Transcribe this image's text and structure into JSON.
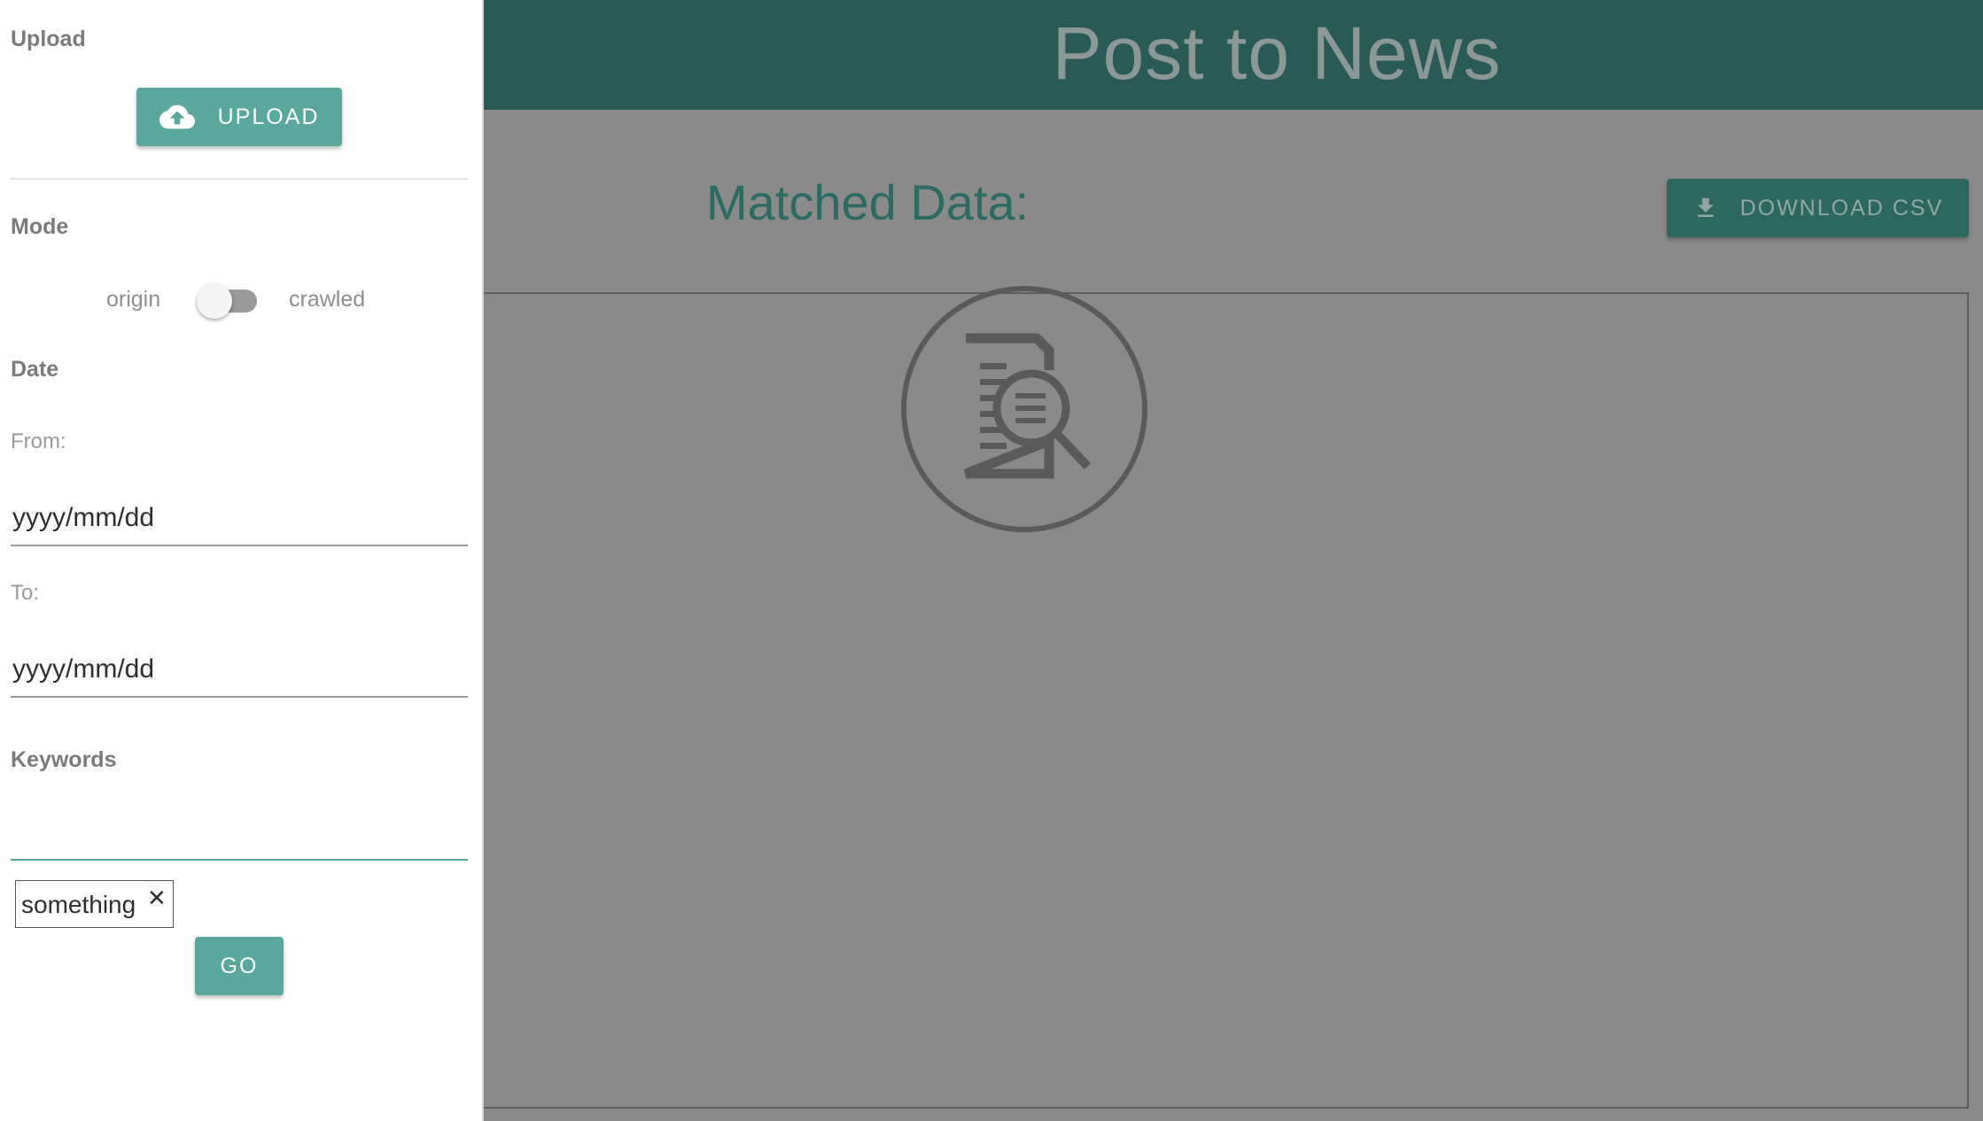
{
  "header": {
    "title": "Post to News"
  },
  "main": {
    "matched_title": "Matched Data:",
    "download_label": "DOWNLOAD CSV",
    "empty_icon": "document-search-icon"
  },
  "sidebar": {
    "upload": {
      "label": "Upload",
      "button_label": "UPLOAD",
      "icon": "cloud-upload-icon"
    },
    "mode": {
      "label": "Mode",
      "left_option": "origin",
      "right_option": "crawled",
      "toggle_on": false
    },
    "date": {
      "label": "Date",
      "from_label": "From:",
      "from_placeholder": "yyyy/mm/dd",
      "to_label": "To:",
      "to_placeholder": "yyyy/mm/dd"
    },
    "keywords": {
      "label": "Keywords",
      "value": "",
      "chips": [
        {
          "text": "something",
          "close": "✕"
        }
      ]
    },
    "go_label": "GO"
  },
  "colors": {
    "header_bg": "#2a5a55",
    "accent": "#5aa89d",
    "overlay": "#8a8a8a"
  }
}
